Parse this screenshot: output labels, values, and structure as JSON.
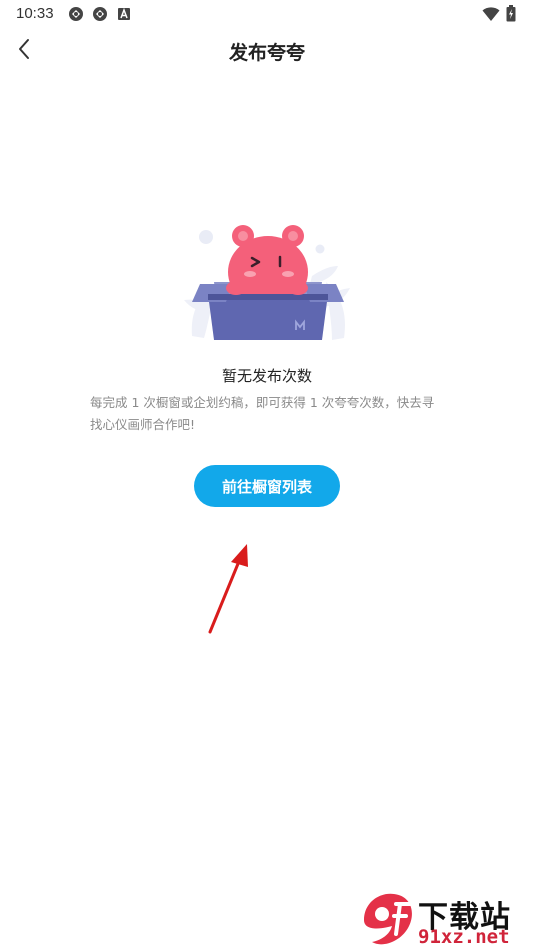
{
  "status_bar": {
    "time": "10:33",
    "left_icons": [
      "app-notification-icon",
      "app-notification-icon",
      "text-notification-icon"
    ],
    "right_icons": [
      "wifi-icon",
      "battery-icon"
    ]
  },
  "nav": {
    "back_icon": "chevron-left-icon",
    "title": "发布夸夸"
  },
  "empty_state": {
    "title": "暂无发布次数",
    "description": "每完成 1 次橱窗或企划约稿，即可获得 1 次夸夸次数，快去寻找心仪画师合作吧!",
    "button_label": "前往橱窗列表"
  },
  "watermark": {
    "logo_text": "9f",
    "top_text": "下载站",
    "bottom_text": "91xz.net"
  },
  "colors": {
    "accent": "#12a8ea",
    "arrow": "#d91c1c",
    "mascot": "#f4607a",
    "box": "#5f67b0"
  }
}
